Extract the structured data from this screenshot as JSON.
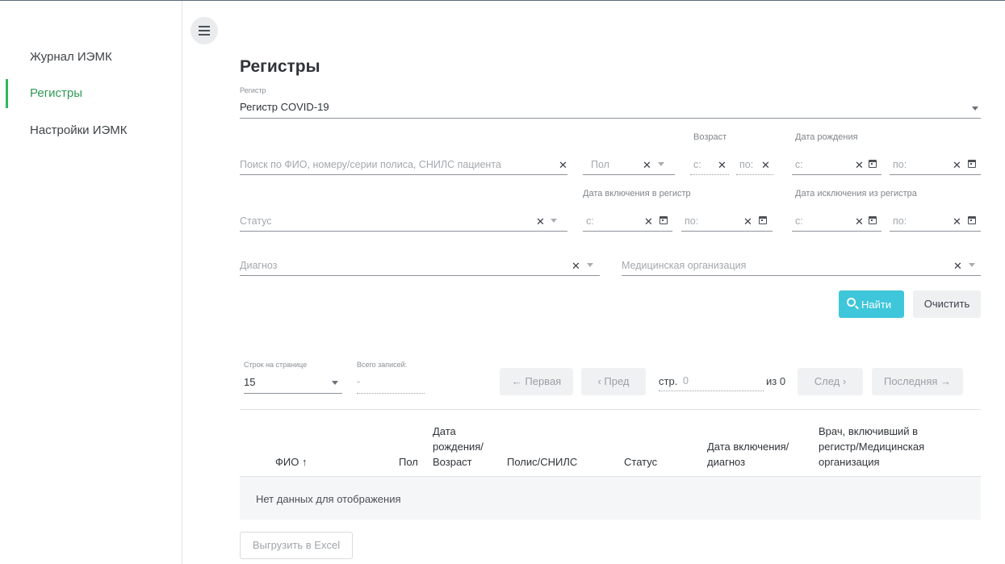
{
  "sidebar": {
    "items": [
      {
        "label": "Журнал ИЭМК",
        "active": false
      },
      {
        "label": "Регистры",
        "active": true
      },
      {
        "label": "Настройки ИЭМК",
        "active": false
      }
    ],
    "active_color": "#2fb85e"
  },
  "page": {
    "title": "Регистры"
  },
  "filters": {
    "registry": {
      "label": "Регистр",
      "value": "Регистр COVID-19"
    },
    "search": {
      "placeholder": "Поиск по ФИО, номеру/серии полиса, СНИЛС пациента"
    },
    "sex": {
      "placeholder": "Пол"
    },
    "age": {
      "label": "Возраст",
      "from": "с:",
      "to": "по:"
    },
    "birth_date": {
      "label": "Дата рождения",
      "from": "с:",
      "to": "по:"
    },
    "status": {
      "placeholder": "Статус"
    },
    "include_date": {
      "label": "Дата включения в регистр",
      "from": "с:",
      "to": "по:"
    },
    "exclude_date": {
      "label": "Дата исключения из регистра",
      "from": "с:",
      "to": "по:"
    },
    "diagnosis": {
      "placeholder": "Диагноз"
    },
    "organization": {
      "placeholder": "Медицинская организация"
    }
  },
  "actions": {
    "find": "Найти",
    "clear": "Очистить",
    "find_color": "#3ec6db"
  },
  "pagination": {
    "rows_label": "Строк на странице",
    "rows_value": "15",
    "total_label": "Всего записей:",
    "total_value": "-",
    "first": "← Первая",
    "prev": "‹ Пред",
    "page_label": "стр.",
    "page_value": "0",
    "of": "из 0",
    "next": "След ›",
    "last": "Последняя →"
  },
  "table": {
    "columns": {
      "fio": "ФИО ↑",
      "sex": "Пол",
      "birth_l1": "Дата",
      "birth_l2": "рождения/",
      "birth_l3": "Возраст",
      "policy": "Полис/СНИЛС",
      "status": "Статус",
      "incl_l1": "Дата включения/",
      "incl_l2": "диагноз",
      "doctor_l1": "Врач, включивший в",
      "doctor_l2": "регистр/Медицинская",
      "doctor_l3": "организация"
    },
    "empty_text": "Нет данных для отображения"
  },
  "export": {
    "label": "Выгрузить в Excel"
  }
}
